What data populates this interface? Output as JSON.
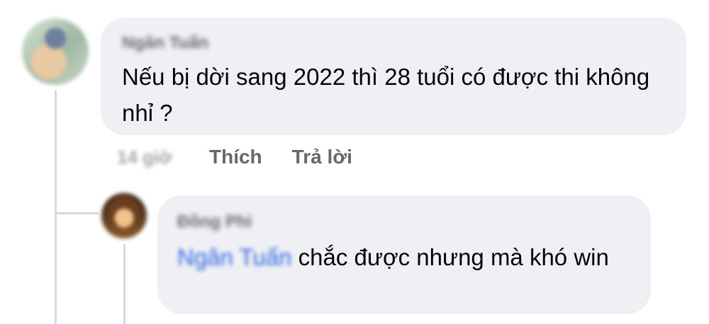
{
  "comment": {
    "author": "Ngân Tuấn",
    "text": "Nếu bị dời sang 2022 thì 28 tuổi có được thi không nhỉ ?",
    "timestamp": "14 giờ",
    "actions": {
      "like": "Thích",
      "reply": "Trả lời"
    }
  },
  "reply": {
    "author": "Đồng Phi",
    "mention": "Ngân Tuấn",
    "text": "chắc được nhưng mà khó win"
  }
}
